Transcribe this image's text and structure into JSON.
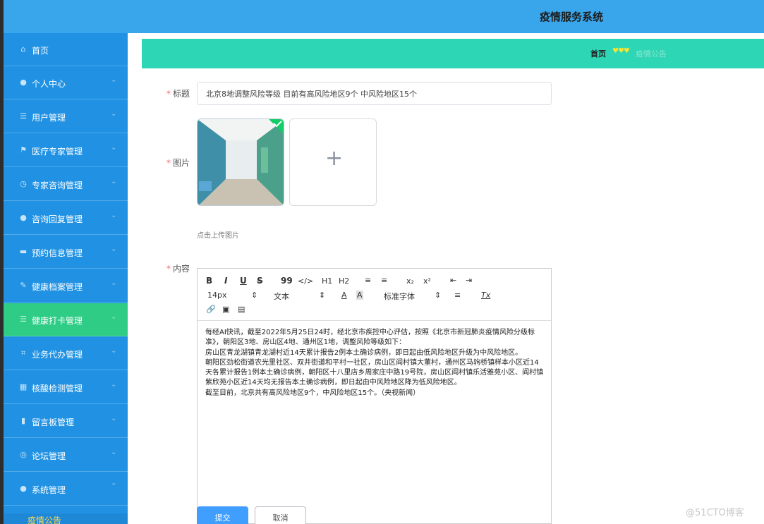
{
  "app": {
    "title": "疫情服务系统"
  },
  "sidebar": {
    "items": [
      {
        "label": "首页",
        "icon": "home-icon"
      },
      {
        "label": "个人中心",
        "icon": "user-icon"
      },
      {
        "label": "用户管理",
        "icon": "list-icon"
      },
      {
        "label": "医疗专家管理",
        "icon": "flag-icon"
      },
      {
        "label": "专家咨询管理",
        "icon": "clock-icon"
      },
      {
        "label": "咨询回复管理",
        "icon": "user-icon"
      },
      {
        "label": "预约信息管理",
        "icon": "ticket-icon"
      },
      {
        "label": "健康档案管理",
        "icon": "brush-icon"
      },
      {
        "label": "健康打卡管理",
        "icon": "list-icon"
      },
      {
        "label": "业务代办管理",
        "icon": "crop-icon"
      },
      {
        "label": "核酸检测管理",
        "icon": "grid-icon"
      },
      {
        "label": "留言板管理",
        "icon": "bar-chart-icon"
      },
      {
        "label": "论坛管理",
        "icon": "globe-icon"
      },
      {
        "label": "系统管理",
        "icon": "user-icon"
      }
    ],
    "submenu": {
      "label": "疫情公告"
    },
    "active_index": 8
  },
  "breadcrumb": {
    "home": "首页",
    "separator": "♥♥♥",
    "current": "疫情公告"
  },
  "form": {
    "title_label": "标题",
    "title_value": "北京8地调整风险等级 目前有高风险地区9个 中风险地区15个",
    "image_label": "图片",
    "upload_tip": "点击上传图片",
    "content_label": "内容",
    "submit": "提交",
    "cancel": "取消"
  },
  "editor": {
    "toolbar": {
      "bold": "B",
      "italic": "I",
      "underline": "U",
      "strike": "S",
      "quote": "99",
      "code": "</>",
      "h1": "H1",
      "h2": "H2",
      "ordered_list": "≡",
      "bullet_list": "≡",
      "subscript": "x₂",
      "superscript": "x²",
      "outdent": "⇤",
      "indent": "⇥",
      "size": "14px",
      "type": "文本",
      "font": "标准字体",
      "align": "≡",
      "clean": "Tx"
    },
    "paragraphs": [
      "每经AI快讯，截至2022年5月25日24时，经北京市疾控中心评估，按照《北京市新冠肺炎疫情风险分级标准》，朝阳区3地、房山区4地、通州区1地，调整风险等级如下：",
      "房山区青龙湖镇青龙湖村近14天累计报告2例本土确诊病例，即日起由低风险地区升级为中风险地区。",
      "朝阳区劲松街道农光里社区、双井街道和平村一社区，房山区阎村镇大董村，通州区马驹桥镇样本小区近14天各累计报告1例本土确诊病例，朝阳区十八里店乡周家庄中路19号院，房山区阎村镇乐活雅苑小区、阎村镇紫欣苑小区近14天均无报告本土确诊病例，即日起由中风险地区降为低风险地区。",
      "截至目前，北京共有高风险地区9个，中风险地区15个。（央视新闻）"
    ]
  },
  "watermark": "@51CTO博客",
  "colors": {
    "topbar": "#39a6ec",
    "sidebar": "#2192e3",
    "active": "#2fcc86",
    "breadcrumb": "#2dd6b4",
    "primary": "#409eff"
  }
}
